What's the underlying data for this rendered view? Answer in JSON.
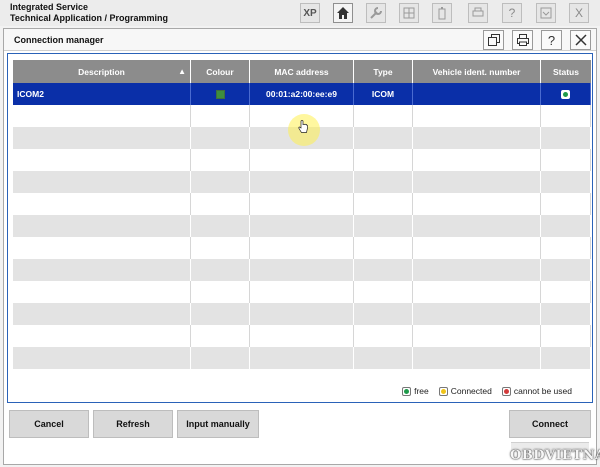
{
  "app": {
    "title_line1": "Integrated Service",
    "title_line2": "Technical Application / Programming",
    "toolbar": {
      "xp_label": "XP",
      "home_icon": "home-icon",
      "wrench_icon": "wrench-icon",
      "grid_icon": "grid-icon",
      "battery_icon": "battery-icon",
      "printer_icon": "printer-icon",
      "help_label": "?",
      "download_icon": "download-icon",
      "close_label": "X"
    }
  },
  "dialog": {
    "title": "Connection manager",
    "header_buttons": {
      "restore_icon": "restore-icon",
      "print_icon": "printer-icon",
      "help_label": "?",
      "close_icon": "close-icon"
    },
    "table": {
      "columns": {
        "description": "Description",
        "colour": "Colour",
        "mac": "MAC address",
        "type": "Type",
        "vin": "Vehicle ident. number",
        "status": "Status"
      },
      "sort_indicator": "▲",
      "rows": [
        {
          "description": "ICOM2",
          "colour_hex": "#3e8e3e",
          "mac": "00:01:a2:00:ee:e9",
          "type": "ICOM",
          "vin": "",
          "status": "free"
        }
      ]
    },
    "legend": {
      "free": "free",
      "connected": "Connected",
      "unavailable": "cannot be used",
      "free_color": "#1e9a4a",
      "connected_color": "#f0c419",
      "unavailable_color": "#d23a3a"
    },
    "buttons": {
      "cancel": "Cancel",
      "refresh": "Refresh",
      "input_manually": "Input manually",
      "connect": "Connect"
    }
  },
  "watermark": "OBDVIETNAM"
}
